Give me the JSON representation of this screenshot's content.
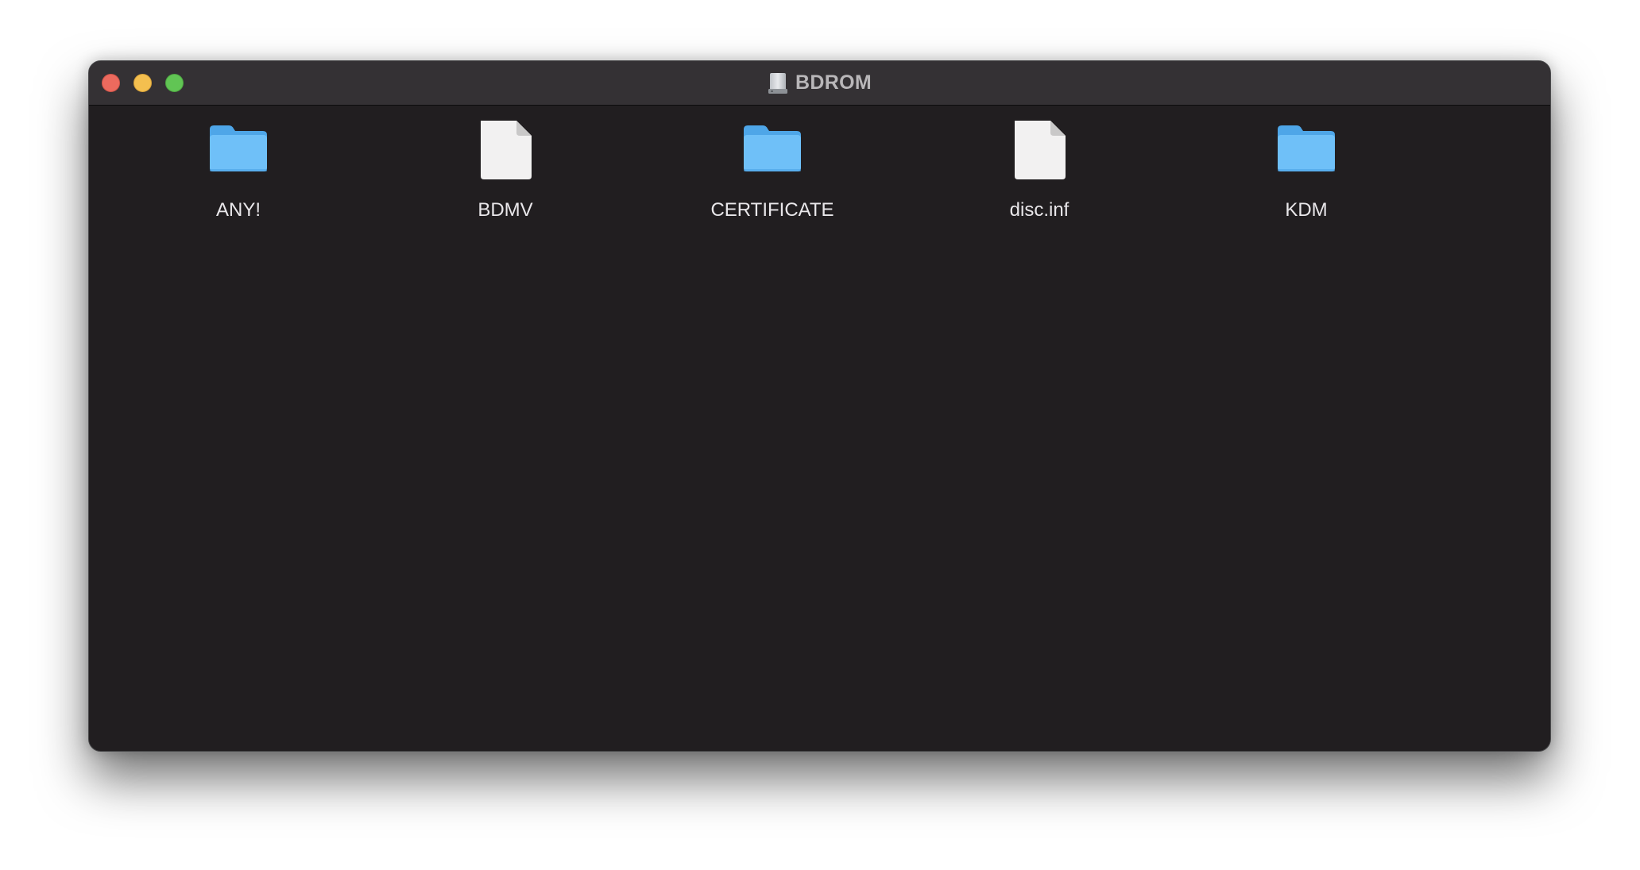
{
  "window": {
    "title": "BDROM",
    "title_icon": "drive-icon"
  },
  "items": [
    {
      "name": "ANY!",
      "kind": "folder",
      "icon": "folder-icon"
    },
    {
      "name": "BDMV",
      "kind": "file",
      "icon": "document-icon"
    },
    {
      "name": "CERTIFICATE",
      "kind": "folder",
      "icon": "folder-icon"
    },
    {
      "name": "disc.inf",
      "kind": "file",
      "icon": "document-icon"
    },
    {
      "name": "KDM",
      "kind": "folder",
      "icon": "folder-icon"
    }
  ],
  "colors": {
    "window_background": "#211e20",
    "titlebar": "#343134",
    "folder_blue": "#6fc0f8",
    "close": "#ec6a5e",
    "minimize": "#f4bf4f",
    "zoom": "#61c554"
  }
}
